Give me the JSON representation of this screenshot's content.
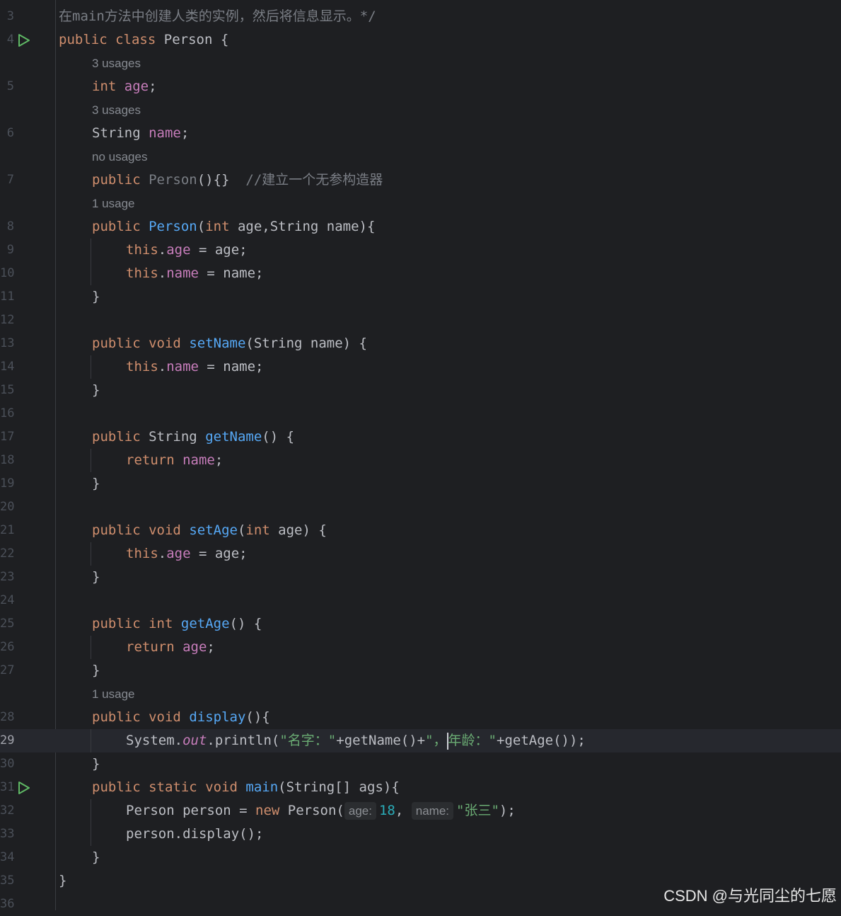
{
  "gutter": {
    "line_numbers": [
      "3",
      "4",
      "5",
      "6",
      "7",
      "8",
      "9",
      "10",
      "11",
      "12",
      "13",
      "14",
      "15",
      "16",
      "17",
      "18",
      "19",
      "20",
      "21",
      "22",
      "23",
      "24",
      "25",
      "26",
      "27",
      "28",
      "29",
      "30",
      "31",
      "32",
      "33",
      "34",
      "35",
      "36"
    ]
  },
  "hints": {
    "age_usages": "3 usages",
    "name_usages": "3 usages",
    "ctor0_usages": "no usages",
    "ctor1_usages": "1 usage",
    "display_usages": "1 usage"
  },
  "code": {
    "l3": {
      "a": "在",
      "b": "main",
      "c": "方法中创建人类的实例，然后将信息显示。*/"
    },
    "l4": {
      "kw1": "public",
      "kw2": "class",
      "rest": "Person {"
    },
    "l5": {
      "kw": "int",
      "fld": "age",
      "rest": ";"
    },
    "l6": {
      "type": "String",
      "fld": "name",
      "rest": ";"
    },
    "l7": {
      "kw": "public",
      "unused": "Person",
      "rest": "(){}",
      "cmt": "//建立一个无参构造器"
    },
    "l8": {
      "kw": "public",
      "fn": "Person",
      "p1": "(",
      "kw2": "int",
      "p2": " age,String name){"
    },
    "l9": {
      "kw": "this",
      "dot": ".",
      "fld": "age",
      "rest": " = age;"
    },
    "l10": {
      "kw": "this",
      "dot": ".",
      "fld": "name",
      "rest": " = name;"
    },
    "l11": "}",
    "l13": {
      "kw1": "public",
      "kw2": "void",
      "fn": "setName",
      "rest": "(String name) {"
    },
    "l14": {
      "kw": "this",
      "dot": ".",
      "fld": "name",
      "rest": " = name;"
    },
    "l15": "}",
    "l17": {
      "kw": "public",
      "type": "String",
      "fn": "getName",
      "rest": "() {"
    },
    "l18": {
      "kw": "return",
      "fld": "name",
      "rest": ";"
    },
    "l19": "}",
    "l21": {
      "kw1": "public",
      "kw2": "void",
      "fn": "setAge",
      "p1": "(",
      "kw3": "int",
      "rest": " age) {"
    },
    "l22": {
      "kw": "this",
      "dot": ".",
      "fld": "age",
      "rest": " = age;"
    },
    "l23": "}",
    "l25": {
      "kw1": "public",
      "kw2": "int",
      "fn": "getAge",
      "rest": "() {"
    },
    "l26": {
      "kw": "return",
      "fld": "age",
      "rest": ";"
    },
    "l27": "}",
    "l28": {
      "kw1": "public",
      "kw2": "void",
      "fn": "display",
      "rest": "(){"
    },
    "l29": {
      "a": "System.",
      "out": "out",
      "b": ".println(",
      "s1": "\"名字：\"",
      "c": "+getName()+",
      "s2a": "\"，",
      "s2b": "年龄：\"",
      "d": "+getAge());"
    },
    "l30": "}",
    "l31": {
      "kw1": "public",
      "kw2": "static",
      "kw3": "void",
      "fn": "main",
      "rest": "(String[] ags){"
    },
    "l32": {
      "a": "Person person = ",
      "kw": "new",
      "b": " Person(",
      "hint1": "age:",
      "num": "18",
      "c": ",",
      "hint2": "name:",
      "str": "\"张三\"",
      "d": ");"
    },
    "l33": "person.display();",
    "l34": "}",
    "l35": "}"
  },
  "colors": {
    "background": "#1e1f22",
    "keyword": "#cf8e6d",
    "field": "#c77dbb",
    "function": "#56a8f5",
    "string": "#6aab73",
    "number": "#2aacb8",
    "comment": "#7a7e85",
    "run_icon": "#5fb865"
  },
  "icons": {
    "run_gutter": "run-triangle-icon"
  },
  "watermark": "CSDN @与光同尘的七愿"
}
